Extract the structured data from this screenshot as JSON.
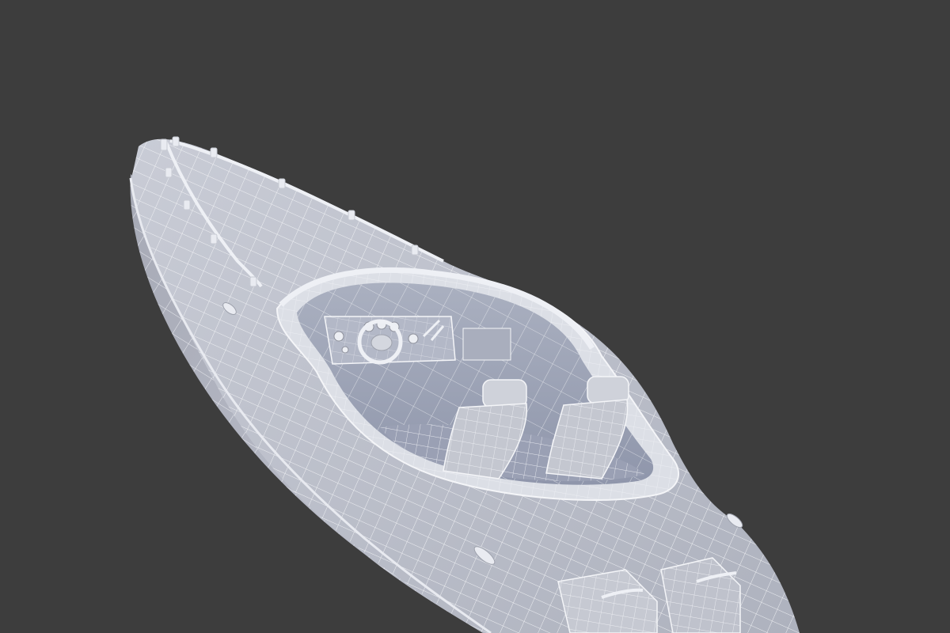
{
  "scene": {
    "subject": "speedboat-wireframe-render",
    "background_color": "#3d3d3d",
    "model_fill_color": "#b9bcc6",
    "model_highlight_color": "#d8dbe3",
    "model_shadow_color": "#8e919c",
    "wire_color": "#f4f5f8",
    "cockpit_floor_color": "#9aa0b4"
  }
}
